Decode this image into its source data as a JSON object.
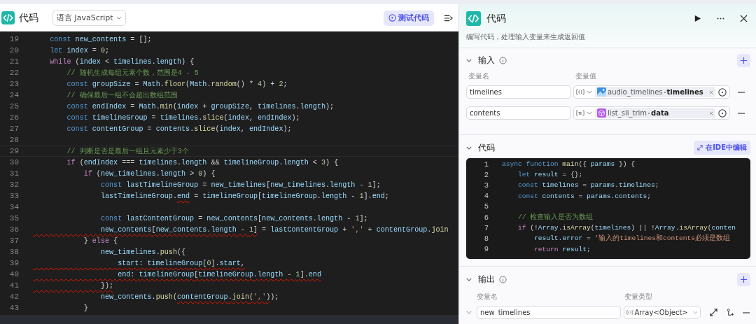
{
  "editor": {
    "title": "代码",
    "language": "语言 JavaScript",
    "test_button": "测试代码",
    "lines": [
      {
        "number": "19",
        "current": false,
        "tokens": [
          {
            "kind": "keyword",
            "text": "    const "
          },
          {
            "kind": "variable",
            "text": "new_contents"
          },
          {
            "kind": "plain",
            "text": " = [];"
          }
        ]
      },
      {
        "number": "20",
        "current": false,
        "tokens": [
          {
            "kind": "keyword",
            "text": "    let "
          },
          {
            "kind": "variable",
            "text": "index"
          },
          {
            "kind": "plain",
            "text": " = "
          },
          {
            "kind": "number",
            "text": "0"
          },
          {
            "kind": "plain",
            "text": ";"
          }
        ]
      },
      {
        "number": "21",
        "current": false,
        "tokens": [
          {
            "kind": "control",
            "text": "    while"
          },
          {
            "kind": "plain",
            "text": " ("
          },
          {
            "kind": "variable",
            "text": "index"
          },
          {
            "kind": "plain",
            "text": " < "
          },
          {
            "kind": "variable",
            "text": "timelines"
          },
          {
            "kind": "plain",
            "text": "."
          },
          {
            "kind": "variable",
            "text": "length"
          },
          {
            "kind": "plain",
            "text": ") {"
          }
        ]
      },
      {
        "number": "22",
        "current": false,
        "tokens": [
          {
            "kind": "comment",
            "text": "        // 随机生成每组元素个数，范围是4 - 5"
          }
        ]
      },
      {
        "number": "23",
        "current": false,
        "tokens": [
          {
            "kind": "keyword",
            "text": "        const "
          },
          {
            "kind": "variable",
            "text": "groupSize"
          },
          {
            "kind": "plain",
            "text": " = "
          },
          {
            "kind": "variable",
            "text": "Math"
          },
          {
            "kind": "plain",
            "text": "."
          },
          {
            "kind": "function",
            "text": "floor"
          },
          {
            "kind": "plain",
            "text": "("
          },
          {
            "kind": "variable",
            "text": "Math"
          },
          {
            "kind": "plain",
            "text": "."
          },
          {
            "kind": "function",
            "text": "random"
          },
          {
            "kind": "plain",
            "text": "() * "
          },
          {
            "kind": "number",
            "text": "4"
          },
          {
            "kind": "plain",
            "text": ") + "
          },
          {
            "kind": "number",
            "text": "2"
          },
          {
            "kind": "plain",
            "text": ";"
          }
        ]
      },
      {
        "number": "24",
        "current": false,
        "tokens": [
          {
            "kind": "comment",
            "text": "        // 确保最后一组不会超出数组范围"
          }
        ]
      },
      {
        "number": "25",
        "current": false,
        "tokens": [
          {
            "kind": "keyword",
            "text": "        const "
          },
          {
            "kind": "variable",
            "text": "endIndex"
          },
          {
            "kind": "plain",
            "text": " = "
          },
          {
            "kind": "variable",
            "text": "Math"
          },
          {
            "kind": "plain",
            "text": "."
          },
          {
            "kind": "function",
            "text": "min"
          },
          {
            "kind": "plain",
            "text": "("
          },
          {
            "kind": "variable",
            "text": "index"
          },
          {
            "kind": "plain",
            "text": " + "
          },
          {
            "kind": "variable",
            "text": "groupSize"
          },
          {
            "kind": "plain",
            "text": ", "
          },
          {
            "kind": "variable",
            "text": "timelines"
          },
          {
            "kind": "plain",
            "text": "."
          },
          {
            "kind": "variable",
            "text": "length"
          },
          {
            "kind": "plain",
            "text": ");"
          }
        ]
      },
      {
        "number": "26",
        "current": false,
        "tokens": [
          {
            "kind": "keyword",
            "text": "        const "
          },
          {
            "kind": "variable",
            "text": "timelineGroup"
          },
          {
            "kind": "plain",
            "text": " = "
          },
          {
            "kind": "variable",
            "text": "timelines"
          },
          {
            "kind": "plain",
            "text": "."
          },
          {
            "kind": "function",
            "text": "slice"
          },
          {
            "kind": "plain",
            "text": "("
          },
          {
            "kind": "variable",
            "text": "index"
          },
          {
            "kind": "plain",
            "text": ", "
          },
          {
            "kind": "variable",
            "text": "endIndex"
          },
          {
            "kind": "plain",
            "text": ");"
          }
        ]
      },
      {
        "number": "27",
        "current": false,
        "tokens": [
          {
            "kind": "keyword",
            "text": "        const "
          },
          {
            "kind": "variable",
            "text": "contentGroup"
          },
          {
            "kind": "plain",
            "text": " = "
          },
          {
            "kind": "variable",
            "text": "contents"
          },
          {
            "kind": "plain",
            "text": "."
          },
          {
            "kind": "function",
            "text": "slice"
          },
          {
            "kind": "plain",
            "text": "("
          },
          {
            "kind": "variable",
            "text": "index"
          },
          {
            "kind": "plain",
            "text": ", "
          },
          {
            "kind": "variable",
            "text": "endIndex"
          },
          {
            "kind": "plain",
            "text": ");"
          }
        ]
      },
      {
        "number": "28",
        "current": false
      },
      {
        "number": "29",
        "current": true,
        "tokens": [
          {
            "kind": "comment",
            "text": "        // 判断是否是最后一组且元素少于3个"
          }
        ]
      },
      {
        "number": "30",
        "current": false,
        "tokens": [
          {
            "kind": "control",
            "text": "        if"
          },
          {
            "kind": "plain",
            "text": " ("
          },
          {
            "kind": "variable",
            "text": "endIndex"
          },
          {
            "kind": "plain",
            "text": " === "
          },
          {
            "kind": "variable",
            "text": "timelines"
          },
          {
            "kind": "plain",
            "text": "."
          },
          {
            "kind": "variable",
            "text": "length"
          },
          {
            "kind": "plain",
            "text": " && "
          },
          {
            "kind": "variable",
            "text": "timelineGroup"
          },
          {
            "kind": "plain",
            "text": "."
          },
          {
            "kind": "variable",
            "text": "length"
          },
          {
            "kind": "plain",
            "text": " < "
          },
          {
            "kind": "number",
            "text": "3"
          },
          {
            "kind": "plain",
            "text": ") {"
          }
        ]
      },
      {
        "number": "31",
        "current": false,
        "tokens": [
          {
            "kind": "control",
            "text": "            if"
          },
          {
            "kind": "plain",
            "text": " ("
          },
          {
            "kind": "variable",
            "text": "new_timelines"
          },
          {
            "kind": "plain",
            "text": "."
          },
          {
            "kind": "variable",
            "text": "length"
          },
          {
            "kind": "plain",
            "text": " > "
          },
          {
            "kind": "number",
            "text": "0"
          },
          {
            "kind": "plain",
            "text": ") {"
          }
        ]
      },
      {
        "number": "32",
        "current": false,
        "tokens": [
          {
            "kind": "keyword",
            "text": "                const "
          },
          {
            "kind": "variable",
            "text": "lastTimelineGroup"
          },
          {
            "kind": "plain",
            "text": " = "
          },
          {
            "kind": "variable",
            "text": "new_timelines"
          },
          {
            "kind": "plain",
            "text": "["
          },
          {
            "kind": "variable",
            "text": "new_timelines"
          },
          {
            "kind": "plain",
            "text": "."
          },
          {
            "kind": "variable",
            "text": "length"
          },
          {
            "kind": "plain",
            "text": " - "
          },
          {
            "kind": "number",
            "text": "1"
          },
          {
            "kind": "plain",
            "text": "];"
          }
        ]
      },
      {
        "number": "33",
        "current": false,
        "tokens": [
          {
            "kind": "variable",
            "text": "                lastTimelineGroup"
          },
          {
            "kind": "plain",
            "text": "."
          },
          {
            "kind": "variable",
            "text": "end",
            "error": true
          },
          {
            "kind": "plain",
            "text": " = "
          },
          {
            "kind": "variable",
            "text": "timelineGroup"
          },
          {
            "kind": "plain",
            "text": "["
          },
          {
            "kind": "variable",
            "text": "timelineGroup"
          },
          {
            "kind": "plain",
            "text": "."
          },
          {
            "kind": "variable",
            "text": "length"
          },
          {
            "kind": "plain",
            "text": " - "
          },
          {
            "kind": "number",
            "text": "1"
          },
          {
            "kind": "plain",
            "text": "]."
          },
          {
            "kind": "variable",
            "text": "end"
          },
          {
            "kind": "plain",
            "text": ";"
          }
        ]
      },
      {
        "number": "34",
        "current": false
      },
      {
        "number": "35",
        "current": false,
        "tokens": [
          {
            "kind": "keyword",
            "text": "                const "
          },
          {
            "kind": "variable",
            "text": "lastContentGroup"
          },
          {
            "kind": "plain",
            "text": " = "
          },
          {
            "kind": "variable",
            "text": "new_contents"
          },
          {
            "kind": "plain",
            "text": "["
          },
          {
            "kind": "variable",
            "text": "new_contents"
          },
          {
            "kind": "plain",
            "text": "."
          },
          {
            "kind": "variable",
            "text": "length"
          },
          {
            "kind": "plain",
            "text": " - "
          },
          {
            "kind": "number",
            "text": "1"
          },
          {
            "kind": "plain",
            "text": "];"
          }
        ]
      },
      {
        "number": "36",
        "current": false,
        "tokens": [
          {
            "kind": "variable",
            "text": "                new_contents",
            "error": true
          },
          {
            "kind": "plain",
            "text": "[",
            "error": true
          },
          {
            "kind": "variable",
            "text": "new_contents",
            "error": true
          },
          {
            "kind": "plain",
            "text": ".",
            "error": true
          },
          {
            "kind": "variable",
            "text": "length",
            "error": true
          },
          {
            "kind": "plain",
            "text": " - ",
            "error": true
          },
          {
            "kind": "number",
            "text": "1",
            "error": true
          },
          {
            "kind": "plain",
            "text": "]",
            "error": true
          },
          {
            "kind": "plain",
            "text": " = "
          },
          {
            "kind": "variable",
            "text": "lastContentGroup"
          },
          {
            "kind": "plain",
            "text": " + "
          },
          {
            "kind": "string",
            "text": "','"
          },
          {
            "kind": "plain",
            "text": " + "
          },
          {
            "kind": "variable",
            "text": "contentGroup"
          },
          {
            "kind": "plain",
            "text": "."
          },
          {
            "kind": "function",
            "text": "join"
          }
        ]
      },
      {
        "number": "37",
        "current": false,
        "tokens": [
          {
            "kind": "plain",
            "text": "            } "
          },
          {
            "kind": "control",
            "text": "else"
          },
          {
            "kind": "plain",
            "text": " {"
          }
        ]
      },
      {
        "number": "38",
        "current": false,
        "tokens": [
          {
            "kind": "variable",
            "text": "                new_timelines"
          },
          {
            "kind": "plain",
            "text": "."
          },
          {
            "kind": "function",
            "text": "push"
          },
          {
            "kind": "plain",
            "text": "({"
          }
        ]
      },
      {
        "number": "39",
        "current": false,
        "tokens": [
          {
            "kind": "variable",
            "text": "                    start",
            "error": true
          },
          {
            "kind": "plain",
            "text": ": ",
            "error": true
          },
          {
            "kind": "variable",
            "text": "timelineGroup",
            "error": true
          },
          {
            "kind": "plain",
            "text": "[",
            "error": true
          },
          {
            "kind": "number",
            "text": "0",
            "error": true
          },
          {
            "kind": "plain",
            "text": "].",
            "error": true
          },
          {
            "kind": "variable",
            "text": "start",
            "error": true
          },
          {
            "kind": "plain",
            "text": ",",
            "error": true
          }
        ]
      },
      {
        "number": "40",
        "current": false,
        "tokens": [
          {
            "kind": "variable",
            "text": "                    end",
            "error": true
          },
          {
            "kind": "plain",
            "text": ": ",
            "error": true
          },
          {
            "kind": "variable",
            "text": "timelineGroup",
            "error": true
          },
          {
            "kind": "plain",
            "text": "[",
            "error": true
          },
          {
            "kind": "variable",
            "text": "timelineGroup",
            "error": true
          },
          {
            "kind": "plain",
            "text": ".",
            "error": true
          },
          {
            "kind": "variable",
            "text": "length",
            "error": true
          },
          {
            "kind": "plain",
            "text": " - ",
            "error": true
          },
          {
            "kind": "number",
            "text": "1",
            "error": true
          },
          {
            "kind": "plain",
            "text": "].",
            "error": true
          },
          {
            "kind": "variable",
            "text": "end",
            "error": true
          }
        ]
      },
      {
        "number": "41",
        "current": false,
        "tokens": [
          {
            "kind": "plain",
            "text": "                });",
            "error": true
          }
        ]
      },
      {
        "number": "42",
        "current": false,
        "tokens": [
          {
            "kind": "variable",
            "text": "                new_contents"
          },
          {
            "kind": "plain",
            "text": "."
          },
          {
            "kind": "function",
            "text": "push"
          },
          {
            "kind": "plain",
            "text": "("
          },
          {
            "kind": "variable",
            "text": "contentGroup",
            "error": true
          },
          {
            "kind": "plain",
            "text": ".",
            "error": true
          },
          {
            "kind": "function",
            "text": "join",
            "error": true
          },
          {
            "kind": "plain",
            "text": "(",
            "error": true
          },
          {
            "kind": "string",
            "text": "','",
            "error": true
          },
          {
            "kind": "plain",
            "text": ")",
            "error": true
          },
          {
            "kind": "plain",
            "text": ");"
          }
        ]
      },
      {
        "number": "43",
        "current": false,
        "tokens": [
          {
            "kind": "plain",
            "text": "            }"
          }
        ]
      }
    ]
  },
  "panel": {
    "title": "代码",
    "description": "编写代码，处理输入变量来生成返回值",
    "input": {
      "title": "输入",
      "name_label": "变量名",
      "value_label": "变量值",
      "rows": [
        {
          "name": "timelines",
          "type_icon": {
            "kind": "array_object"
          },
          "source": {
            "kind": "image",
            "node": "audio_timelines",
            "field": "timelines"
          }
        },
        {
          "name": "contents",
          "type_icon": {
            "kind": "array_string"
          },
          "source": {
            "kind": "cube",
            "node": "list_sli_trim",
            "field": "data"
          }
        }
      ]
    },
    "code": {
      "title": "代码",
      "ide_button": "在IDE中编辑",
      "lines": [
        {
          "number": "1",
          "tokens": [
            {
              "kind": "keyword",
              "text": "async function "
            },
            {
              "kind": "function",
              "text": "main"
            },
            {
              "kind": "plain",
              "text": "({ "
            },
            {
              "kind": "variable",
              "text": "params"
            },
            {
              "kind": "plain",
              "text": " }) {"
            }
          ]
        },
        {
          "number": "2",
          "tokens": [
            {
              "kind": "keyword",
              "text": "    let "
            },
            {
              "kind": "variable",
              "text": "result"
            },
            {
              "kind": "plain",
              "text": " = {};"
            }
          ]
        },
        {
          "number": "3",
          "tokens": [
            {
              "kind": "keyword",
              "text": "    const "
            },
            {
              "kind": "variable",
              "text": "timelines"
            },
            {
              "kind": "plain",
              "text": " = "
            },
            {
              "kind": "variable",
              "text": "params"
            },
            {
              "kind": "plain",
              "text": "."
            },
            {
              "kind": "variable",
              "text": "timelines"
            },
            {
              "kind": "plain",
              "text": ";"
            }
          ]
        },
        {
          "number": "4",
          "tokens": [
            {
              "kind": "keyword",
              "text": "    const "
            },
            {
              "kind": "variable",
              "text": "contents"
            },
            {
              "kind": "plain",
              "text": " = "
            },
            {
              "kind": "variable",
              "text": "params"
            },
            {
              "kind": "plain",
              "text": "."
            },
            {
              "kind": "variable",
              "text": "contents"
            },
            {
              "kind": "plain",
              "text": ";"
            }
          ]
        },
        {
          "number": "5"
        },
        {
          "number": "6",
          "tokens": [
            {
              "kind": "comment",
              "text": "    // 检查输入是否为数组"
            }
          ]
        },
        {
          "number": "7",
          "tokens": [
            {
              "kind": "control",
              "text": "    if"
            },
            {
              "kind": "plain",
              "text": " (!"
            },
            {
              "kind": "variable",
              "text": "Array"
            },
            {
              "kind": "plain",
              "text": "."
            },
            {
              "kind": "function",
              "text": "isArray"
            },
            {
              "kind": "plain",
              "text": "("
            },
            {
              "kind": "variable",
              "text": "timelines"
            },
            {
              "kind": "plain",
              "text": ") || !"
            },
            {
              "kind": "variable",
              "text": "Array"
            },
            {
              "kind": "plain",
              "text": "."
            },
            {
              "kind": "function",
              "text": "isArray"
            },
            {
              "kind": "plain",
              "text": "("
            },
            {
              "kind": "variable",
              "text": "conten"
            }
          ]
        },
        {
          "number": "8",
          "tokens": [
            {
              "kind": "variable",
              "text": "        result"
            },
            {
              "kind": "plain",
              "text": "."
            },
            {
              "kind": "variable",
              "text": "error"
            },
            {
              "kind": "plain",
              "text": " = "
            },
            {
              "kind": "string",
              "text": "'输入的timelines和contents必须是数组"
            }
          ]
        },
        {
          "number": "9",
          "tokens": [
            {
              "kind": "control",
              "text": "        return "
            },
            {
              "kind": "variable",
              "text": "result"
            },
            {
              "kind": "plain",
              "text": ";"
            }
          ]
        }
      ]
    },
    "output": {
      "title": "输出",
      "name_label": "变量名",
      "type_label": "变量类型",
      "rows": [
        {
          "name": "new_timelines",
          "type": {
            "kind": "array_object",
            "label": "Array<Object>"
          }
        }
      ]
    }
  }
}
